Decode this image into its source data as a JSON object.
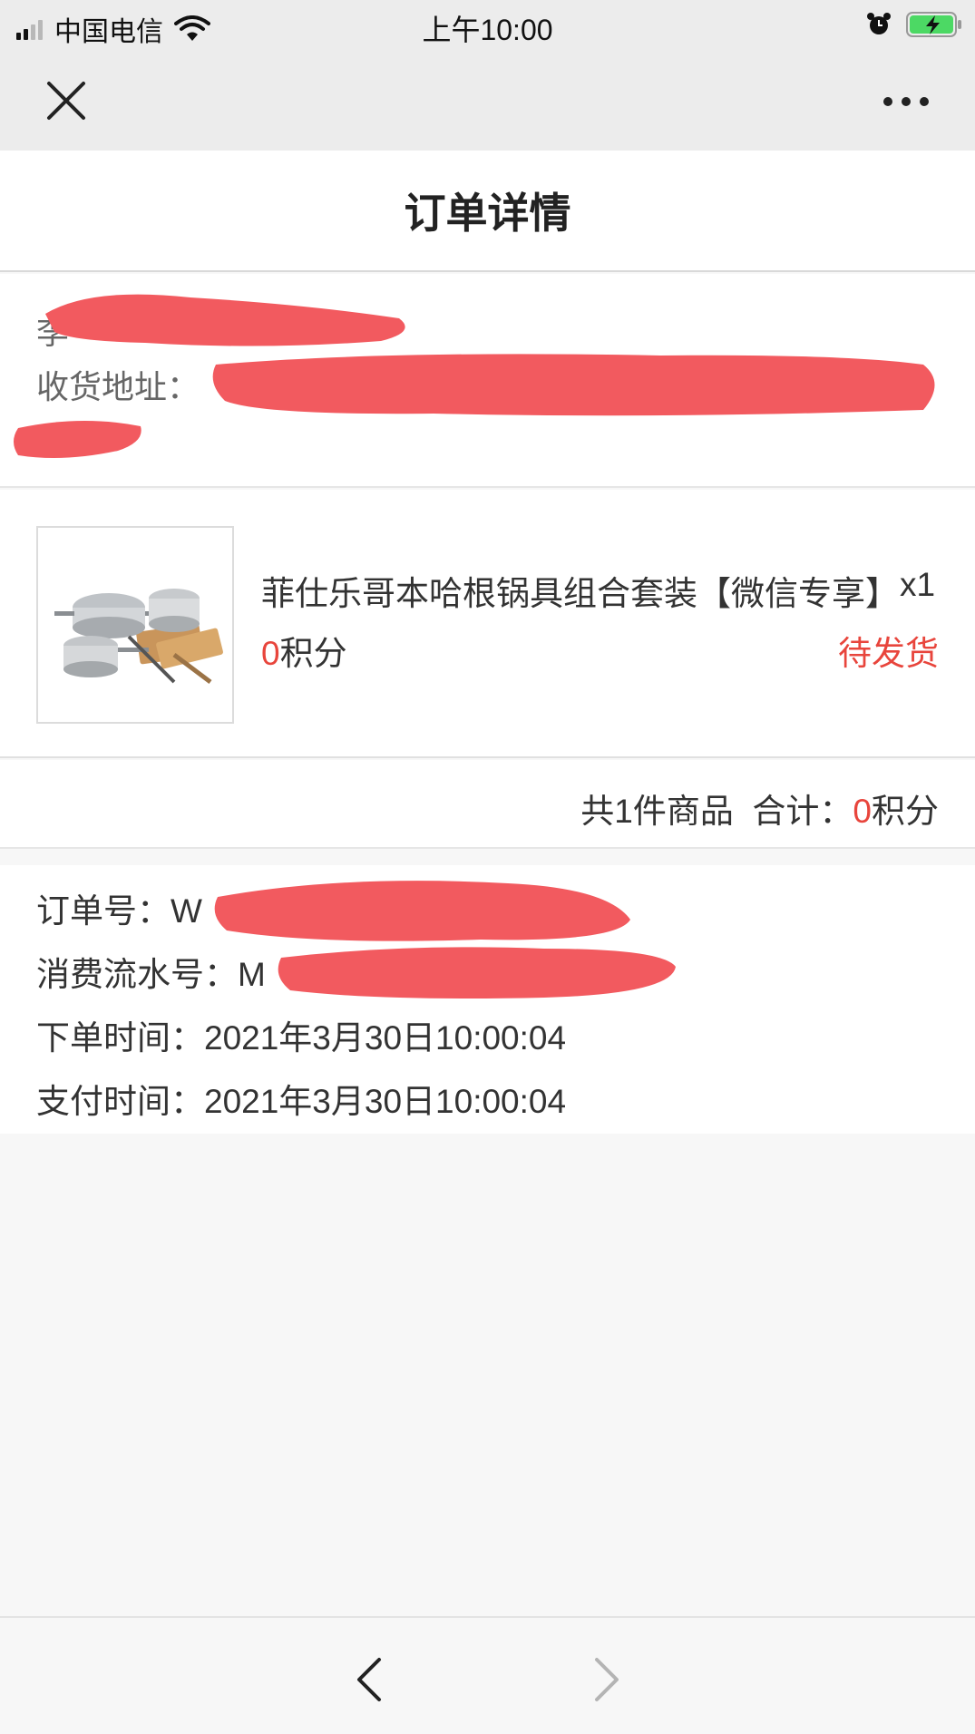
{
  "status_bar": {
    "carrier": "中国电信",
    "time": "上午10:00"
  },
  "nav": {
    "close_icon": "close-icon",
    "more_icon": "more-dots-icon"
  },
  "page_title": "订单详情",
  "address": {
    "receiver_label_partial": "李",
    "address_label": "收货地址："
  },
  "product": {
    "image": "cookware-set-image",
    "name": "菲仕乐哥本哈根锅具组合套装【微信专享】",
    "quantity": "x1",
    "points_value": "0",
    "points_unit": "积分",
    "status": "待发货"
  },
  "summary": {
    "count_text": "共1件商品",
    "total_label": "合计：",
    "total_value": "0",
    "total_unit": "积分"
  },
  "order_info": {
    "order_no_label": "订单号：",
    "order_no_visible": "W",
    "serial_label": "消费流水号：",
    "serial_visible": "M",
    "order_time_label": "下单时间：",
    "order_time": "2021年3月30日10:00:04",
    "pay_time_label": "支付时间：",
    "pay_time": "2021年3月30日10:00:04"
  },
  "bottom_nav": {
    "back_icon": "chevron-left-icon",
    "forward_icon": "chevron-right-icon"
  },
  "colors": {
    "accent_red": "#e8453c",
    "redaction": "#f25a5f"
  }
}
